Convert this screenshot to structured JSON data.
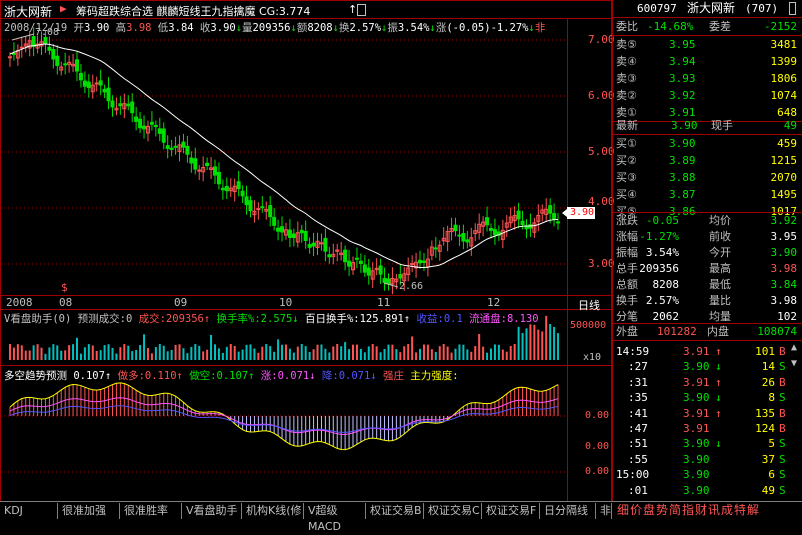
{
  "header": {
    "stock_name": "浙大网新",
    "indicators": "筹码超跌综合选  麒麟短线王九指擒魔  CG:3.774",
    "indicator_arrow": "↑"
  },
  "info_line": {
    "date": "2008/12/19",
    "open_label": "开",
    "open": "3.90",
    "high_label": "高",
    "high": "3.98",
    "low_label": "低",
    "low": "3.84",
    "close_label": "收",
    "close": "3.90",
    "vol_label": "量",
    "vol": "209356",
    "amount_label": "额",
    "amount": "8208",
    "turn_label": "换",
    "turn": "2.57%",
    "amp_label": "振",
    "amp": "3.54%",
    "chg_label": "涨",
    "chg": "(-0.05)-1.27%",
    "tail": "非"
  },
  "kline": {
    "max_label": "7.08",
    "min_label": "2.66",
    "price_axis": [
      "7.00",
      "6.00",
      "5.00",
      "4.00",
      "3.00"
    ],
    "current_price_tag": "3.90",
    "month_labels": [
      "2008",
      "08",
      "09",
      "10",
      "11",
      "12"
    ],
    "dollar_marker": "$",
    "period_label": "日线"
  },
  "volume_panel": {
    "title": "V看盘助手(0)",
    "forecast_label": "预测成交:0",
    "vol_label": "成交:209356",
    "turn_label": "换手率%:2.575",
    "turn100_label": "百日换手%:125.891",
    "profit_label": "收益:0.1",
    "float_label": "流通盘:8.130",
    "axis_top": "500000",
    "axis_unit": "x10"
  },
  "trend_panel": {
    "title": "多空趋势预测",
    "value": "0.107",
    "short_label": "做多:0.110",
    "long_label": "做空:0.107",
    "up_label": "涨:0.071",
    "down_label": "降:0.071",
    "strong_label": "强庄",
    "main_force_label": "主力强度:",
    "axis": [
      "0.00",
      "0.00",
      "0.00"
    ]
  },
  "quote": {
    "code": "600797",
    "name": "浙大网新",
    "count": "(707)",
    "wei_bi_label": "委比",
    "wei_bi": "-14.68%",
    "wei_cha_label": "委差",
    "wei_cha": "-2152",
    "asks": [
      {
        "label": "卖⑤",
        "price": "3.95",
        "vol": "3481"
      },
      {
        "label": "卖④",
        "price": "3.94",
        "vol": "1399"
      },
      {
        "label": "卖③",
        "price": "3.93",
        "vol": "1806"
      },
      {
        "label": "卖②",
        "price": "3.92",
        "vol": "1074"
      },
      {
        "label": "卖①",
        "price": "3.91",
        "vol": "648"
      }
    ],
    "latest_label": "最新",
    "latest": "3.90",
    "now_hand_label": "现手",
    "now_hand": "49",
    "bids": [
      {
        "label": "买①",
        "price": "3.90",
        "vol": "459"
      },
      {
        "label": "买②",
        "price": "3.89",
        "vol": "1215"
      },
      {
        "label": "买③",
        "price": "3.88",
        "vol": "2070"
      },
      {
        "label": "买④",
        "price": "3.87",
        "vol": "1495"
      },
      {
        "label": "买⑤",
        "price": "3.86",
        "vol": "1017"
      }
    ],
    "stats": [
      {
        "l1": "涨跌",
        "v1": "-0.05",
        "l2": "均价",
        "v2": "3.92",
        "c1": "green",
        "c2": "green"
      },
      {
        "l1": "涨幅",
        "v1": "-1.27%",
        "l2": "前收",
        "v2": "3.95",
        "c1": "green",
        "c2": "white"
      },
      {
        "l1": "振幅",
        "v1": "3.54%",
        "l2": "今开",
        "v2": "3.90",
        "c1": "white",
        "c2": "green"
      },
      {
        "l1": "总手",
        "v1": "209356",
        "l2": "最高",
        "v2": "3.98",
        "c1": "white",
        "c2": "red"
      },
      {
        "l1": "总额",
        "v1": "8208",
        "l2": "最低",
        "v2": "3.84",
        "c1": "white",
        "c2": "green"
      },
      {
        "l1": "换手",
        "v1": "2.57%",
        "l2": "量比",
        "v2": "3.98",
        "c1": "white",
        "c2": "white"
      },
      {
        "l1": "分笔",
        "v1": "2062",
        "l2": "均量",
        "v2": "102",
        "c1": "white",
        "c2": "white"
      }
    ],
    "outer_label": "外盘",
    "outer": "101282",
    "inner_label": "内盘",
    "inner": "108074"
  },
  "ticks": [
    {
      "time": "14:59",
      "price": "3.91",
      "dir": "↑",
      "vol": "101",
      "bs": "B"
    },
    {
      "time": ":27",
      "price": "3.90",
      "dir": "↓",
      "vol": "14",
      "bs": "S"
    },
    {
      "time": ":31",
      "price": "3.91",
      "dir": "↑",
      "vol": "26",
      "bs": "B"
    },
    {
      "time": ":35",
      "price": "3.90",
      "dir": "↓",
      "vol": "8",
      "bs": "S"
    },
    {
      "time": ":41",
      "price": "3.91",
      "dir": "↑",
      "vol": "135",
      "bs": "B"
    },
    {
      "time": ":47",
      "price": "3.91",
      "dir": "",
      "vol": "124",
      "bs": "B"
    },
    {
      "time": ":51",
      "price": "3.90",
      "dir": "↓",
      "vol": "5",
      "bs": "S"
    },
    {
      "time": ":55",
      "price": "3.90",
      "dir": "",
      "vol": "37",
      "bs": "S"
    },
    {
      "time": "15:00",
      "price": "3.90",
      "dir": "",
      "vol": "6",
      "bs": "S"
    },
    {
      "time": ":01",
      "price": "3.90",
      "dir": "",
      "vol": "49",
      "bs": "S"
    }
  ],
  "side_tabs": "细价盘势简指财讯成特解",
  "bottom_tabs": [
    "KDJ",
    "很准加强",
    "很准胜率",
    "V看盘助手",
    "机构K线(修",
    "V超级MACD",
    "权证交易B",
    "权证交易C",
    "权证交易F",
    "日分隔线",
    "非"
  ],
  "colors": {
    "up": "#ff5454",
    "down": "#00e000",
    "frame": "#a00000",
    "ma": "#ffffff"
  }
}
